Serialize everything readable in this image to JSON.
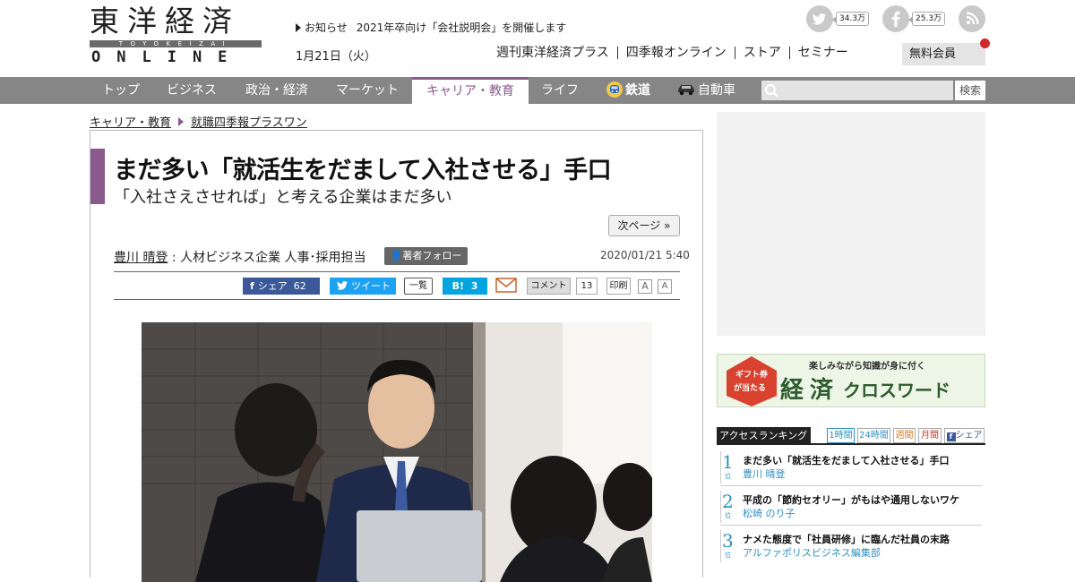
{
  "header": {
    "logo_kanji": "東洋経済",
    "logo_sub": "TOYOKEIZAI",
    "logo_online": "ONLINE",
    "notice_label": "お知らせ",
    "notice_text": "2021年卒向け「会社説明会」を開催します",
    "date": "1月21日（火）",
    "links": [
      "週刊東洋経済プラス",
      "四季報オンライン",
      "ストア",
      "セミナー"
    ],
    "member_label": "無料会員",
    "twitter_count": "34.3万",
    "facebook_count": "25.3万"
  },
  "nav": {
    "items": [
      "トップ",
      "ビジネス",
      "政治・経済",
      "マーケット",
      "キャリア・教育",
      "ライフ",
      "鉄道",
      "自動車"
    ],
    "active": "キャリア・教育",
    "search_button": "検索"
  },
  "breadcrumb": [
    "キャリア・教育",
    "就職四季報プラスワン"
  ],
  "article": {
    "title": "まだ多い「就活生をだまして入社させる」手口",
    "subtitle": "「入社さえさせれば」と考える企業はまだ多い",
    "next_page": "次ページ »",
    "author_name": "豊川 晴登",
    "author_role": " : 人材ビジネス企業 人事･採用担当",
    "follow_label": "著者フォロー",
    "date": "2020/01/21 5:40",
    "share": {
      "fb_label": "シェア",
      "fb_count": "62",
      "tw_label": "ツイート",
      "list_label": "一覧",
      "hatena_label": "B!",
      "hatena_count": "3",
      "comment_label": "コメント",
      "comment_count": "13",
      "print_label": "印刷",
      "font_a": "A"
    }
  },
  "sidebar": {
    "banner_badge_1": "ギフト券",
    "banner_badge_2": "が当たる",
    "banner_tagline": "楽しみながら知識が身に付く",
    "banner_title_1": "経",
    "banner_title_2": "済",
    "banner_title_3": "クロスワード",
    "ranking_title": "アクセスランキング",
    "ranking_tabs": [
      "1時間",
      "24時間",
      "週間",
      "月間",
      "シェア"
    ],
    "ranking_items": [
      {
        "rank": "1",
        "suffix": "位",
        "title": "まだ多い「就活生をだまして入社させる」手口",
        "author": "豊川 晴登"
      },
      {
        "rank": "2",
        "suffix": "位",
        "title": "平成の「節約セオリー」がもはや通用しないワケ",
        "author": "松崎 のり子"
      },
      {
        "rank": "3",
        "suffix": "位",
        "title": "ナメた態度で「社員研修」に臨んだ社員の末路",
        "author": "アルファポリスビジネス編集部"
      }
    ]
  },
  "colors": {
    "accent": "#8a5a8f",
    "nav_bg": "#868686",
    "ranking_blue": "#2f8fbf",
    "facebook": "#3b5998",
    "twitter": "#1da1f2",
    "hatena": "#00a4de"
  }
}
